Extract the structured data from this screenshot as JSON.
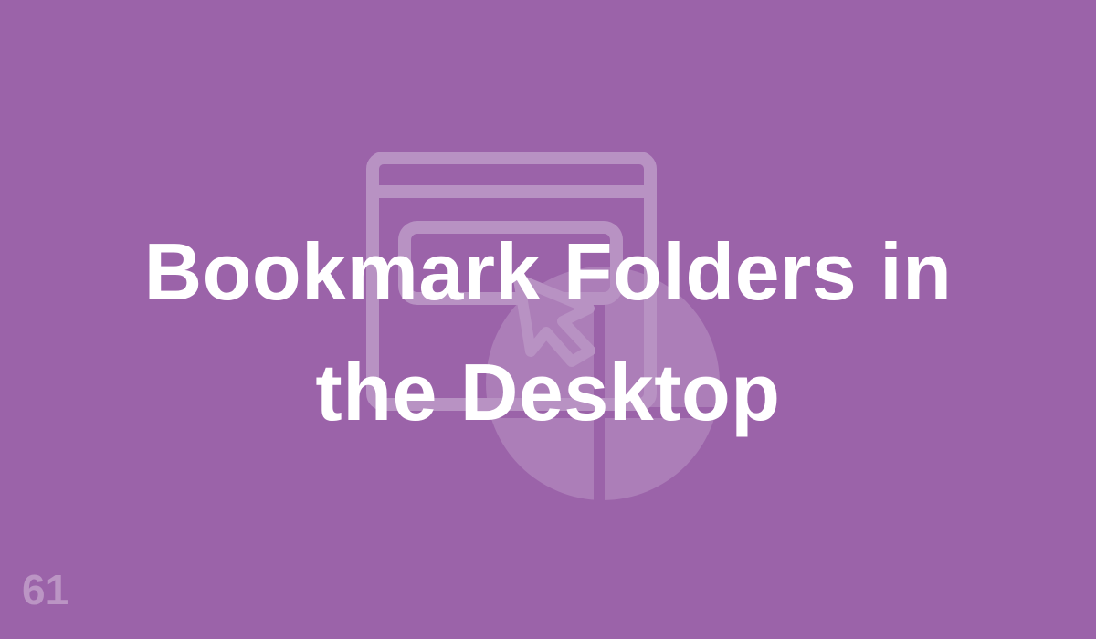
{
  "colors": {
    "background": "#9b63a9",
    "illustration_stroke": "#b892c3",
    "illustration_fill": "#ac7eb8",
    "title_text": "#ffffff"
  },
  "illustration": {
    "icon": "browser-window-pie-chart-cursor-icon"
  },
  "title": {
    "line1": "Bookmark Folders in",
    "line2": "the Desktop"
  },
  "page_number": "61"
}
